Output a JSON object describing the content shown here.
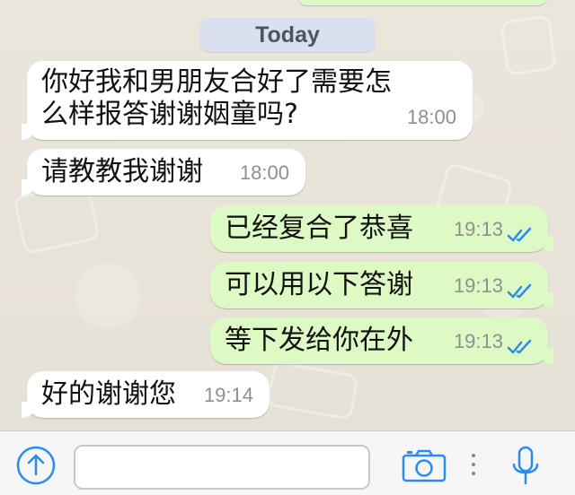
{
  "date_divider": "Today",
  "messages": [
    {
      "direction": "incoming",
      "text_lines": [
        "你好我和男朋友合好了需要怎",
        "么样报答谢谢姻童吗?"
      ],
      "time": "18:00"
    },
    {
      "direction": "incoming",
      "text": "请教教我谢谢",
      "time": "18:00"
    },
    {
      "direction": "outgoing",
      "text": "已经复合了恭喜",
      "time": "19:13",
      "status": "read"
    },
    {
      "direction": "outgoing",
      "text": "可以用以下答谢",
      "time": "19:13",
      "status": "read"
    },
    {
      "direction": "outgoing",
      "text": "等下发给你在外",
      "time": "19:13",
      "status": "read"
    },
    {
      "direction": "incoming",
      "text": "好的谢谢您",
      "time": "19:14"
    }
  ],
  "composer": {
    "input_value": "",
    "placeholder": ""
  },
  "icons": {
    "share": "share-icon",
    "camera": "camera-icon",
    "microphone": "microphone-icon",
    "read_ticks": "double-check-icon"
  },
  "colors": {
    "outgoing_bubble": "#ddf9c4",
    "incoming_bubble": "#ffffff",
    "accent_blue": "#2a8cf0",
    "date_pill": "#d9e1f0"
  }
}
